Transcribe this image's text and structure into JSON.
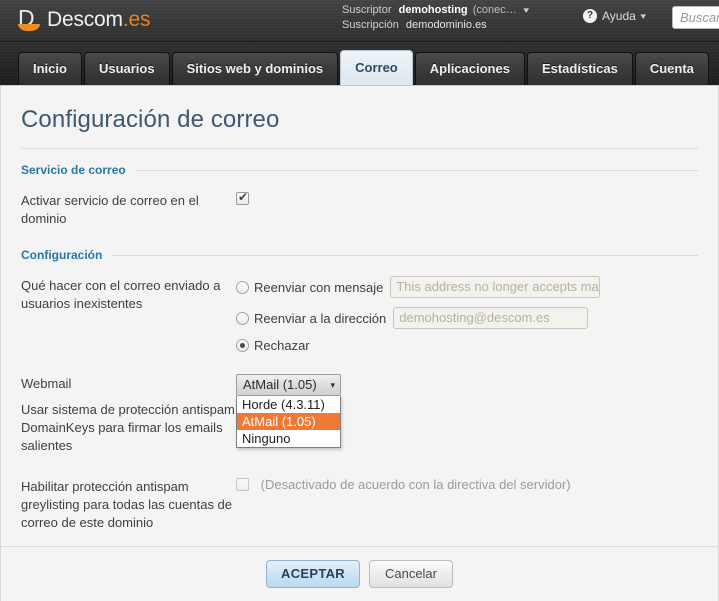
{
  "header": {
    "logo": {
      "mark_letter": "D",
      "name": "Descom",
      "tld": ".es"
    },
    "subscriber": {
      "label": "Suscriptor",
      "value": "demohosting",
      "extra": "(conec…",
      "caret": "▾"
    },
    "subscription": {
      "label": "Suscripción",
      "value": "demodominio.es"
    },
    "help": {
      "icon_glyph": "?",
      "label": "Ayuda",
      "caret": "▾"
    },
    "search": {
      "placeholder": "Buscar...",
      "value": ""
    }
  },
  "nav": {
    "tabs": [
      {
        "label": "Inicio",
        "active": false
      },
      {
        "label": "Usuarios",
        "active": false
      },
      {
        "label": "Sitios web y dominios",
        "active": false
      },
      {
        "label": "Correo",
        "active": true
      },
      {
        "label": "Aplicaciones",
        "active": false
      },
      {
        "label": "Estadísticas",
        "active": false
      },
      {
        "label": "Cuenta",
        "active": false
      }
    ]
  },
  "page": {
    "title": "Configuración de correo",
    "sections": {
      "mail_service": {
        "heading": "Servicio de correo",
        "activate": {
          "label": "Activar servicio de correo en el dominio",
          "checked": true
        }
      },
      "configuration": {
        "heading": "Configuración",
        "nonexistent_users": {
          "label": "Qué hacer con el correo enviado a usuarios inexistentes",
          "options": [
            {
              "label": "Reenviar con mensaje",
              "selected": false,
              "input_value": "This address no longer accepts mai"
            },
            {
              "label": "Reenviar a la dirección",
              "selected": false,
              "input_value": "demohosting@descom.es"
            },
            {
              "label": "Rechazar",
              "selected": true
            }
          ]
        },
        "webmail": {
          "label": "Webmail",
          "selected_value": "AtMail (1.05)",
          "arrow_glyph": "▾",
          "open": true,
          "options": [
            {
              "label": "Horde (4.3.11)",
              "selected": false
            },
            {
              "label": "AtMail (1.05)",
              "selected": true
            },
            {
              "label": "Ninguno",
              "selected": false
            }
          ]
        },
        "domainkeys": {
          "label": "Usar sistema de protección antispam DomainKeys para firmar los emails salientes"
        },
        "greylisting": {
          "label": "Habilitar protección antispam greylisting para todas las cuentas de correo de este dominio",
          "checked": false,
          "note": "(Desactivado de acuerdo con la directiva del servidor)"
        }
      }
    },
    "buttons": {
      "accept": "ACEPTAR",
      "cancel": "Cancelar"
    }
  },
  "colors": {
    "brand_orange": "#ee7f1f",
    "section_blue": "#2579a9",
    "title_blue": "#3f5770",
    "dropdown_highlight": "#f07a35"
  }
}
